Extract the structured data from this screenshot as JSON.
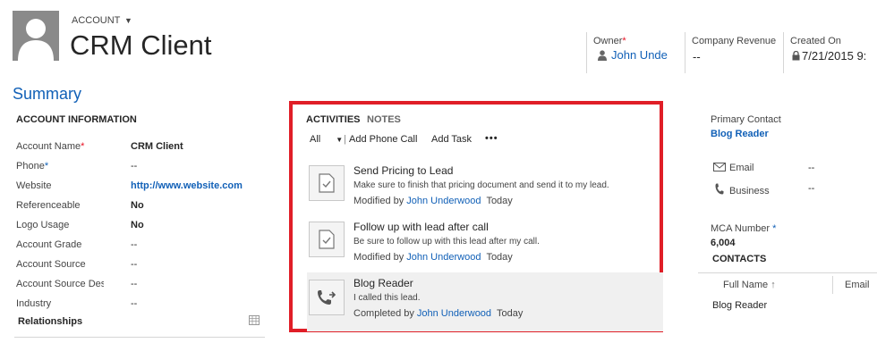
{
  "header": {
    "entity_type": "ACCOUNT",
    "record_name": "CRM Client",
    "fields": [
      {
        "label": "Owner",
        "value": "John Unde"
      },
      {
        "label": "Company Revenue",
        "value": "--"
      },
      {
        "label": "Created On",
        "value": "7/21/2015  9:"
      }
    ]
  },
  "summary": {
    "title": "Summary",
    "account_info": {
      "heading": "ACCOUNT INFORMATION",
      "rows": [
        {
          "label": "Account Name",
          "value": "CRM Client"
        },
        {
          "label": "Phone",
          "value": "--"
        },
        {
          "label": "Website",
          "value": "http://www.website.com"
        },
        {
          "label": "Referenceable",
          "value": "No"
        },
        {
          "label": "Logo Usage",
          "value": "No"
        },
        {
          "label": "Account Grade",
          "value": "--"
        },
        {
          "label": "Account Source",
          "value": "--"
        },
        {
          "label": "Account Source Desc",
          "value": "--"
        },
        {
          "label": "Industry",
          "value": "--"
        }
      ]
    },
    "relationships_heading": "Relationships"
  },
  "activities": {
    "tabs": [
      "ACTIVITIES",
      "NOTES"
    ],
    "filter": "All",
    "toolbar": {
      "add_phone_call": "Add Phone Call",
      "add_task": "Add Task",
      "more": "•••"
    },
    "items": [
      {
        "icon": "task-icon",
        "title": "Send Pricing to Lead",
        "description": "Make sure to finish that pricing document and send it to my lead.",
        "meta_prefix": "Modified by",
        "user": "John Underwood",
        "when": "Today"
      },
      {
        "icon": "task-icon",
        "title": "Follow up with lead after call",
        "description": "Be sure to follow up with this lead after my call.",
        "meta_prefix": "Modified by",
        "user": "John Underwood",
        "when": "Today"
      },
      {
        "icon": "phone-call-icon",
        "title": "Blog Reader",
        "description": "I called this lead.",
        "meta_prefix": "Completed by",
        "user": "John Underwood",
        "when": "Today"
      }
    ]
  },
  "right": {
    "primary_contact_label": "Primary Contact",
    "primary_contact": "Blog Reader",
    "email_label": "Email",
    "email_value": "--",
    "business_label": "Business",
    "business_value": "--",
    "mca_label": "MCA Number",
    "mca_value": "6,004",
    "contacts_heading": "CONTACTS",
    "contacts_columns": [
      "Full Name",
      "Email"
    ],
    "contacts_rows": [
      "Blog Reader"
    ]
  },
  "colors": {
    "accent": "#1160b7",
    "highlight_border": "#e01e27",
    "required": "#e81123"
  }
}
